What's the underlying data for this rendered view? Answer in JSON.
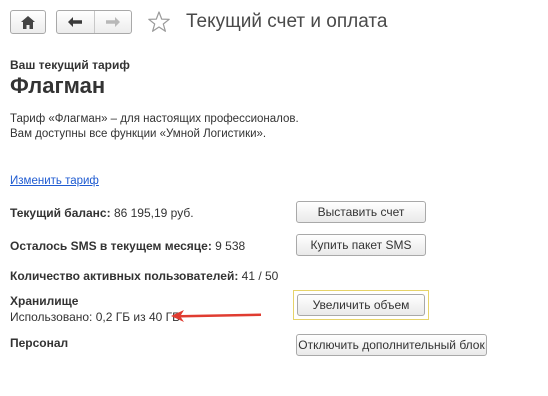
{
  "header": {
    "title": "Текущий счет и оплата",
    "icons": {
      "home": "home-icon",
      "back": "arrow-left-icon",
      "forward": "arrow-right-icon",
      "favorite": "star-icon"
    }
  },
  "tariff": {
    "heading": "Ваш текущий тариф",
    "name": "Флагман",
    "description": "Тариф «Флагман» – для настоящих профессионалов. Вам доступны все функции «Умной Логистики».",
    "change_link": "Изменить тариф"
  },
  "balance": {
    "label": "Текущий баланс:",
    "value": " 86 195,19 руб.",
    "button": "Выставить счет"
  },
  "sms": {
    "label": "Осталось SMS в текущем месяце:",
    "value": " 9 538",
    "button": "Купить пакет SMS"
  },
  "users": {
    "label": "Количество активных пользователей:",
    "value": " 41 / 50"
  },
  "storage": {
    "label": "Хранилище",
    "usage": "Использовано: 0,2 ГБ из 40 ГБ",
    "button": "Увеличить объем"
  },
  "personal": {
    "label": "Персонал",
    "button": "Отключить дополнительный блок"
  },
  "colors": {
    "link": "#1f5bd1",
    "arrow": "#e03c31",
    "focus_frame": "#e6d36a"
  }
}
